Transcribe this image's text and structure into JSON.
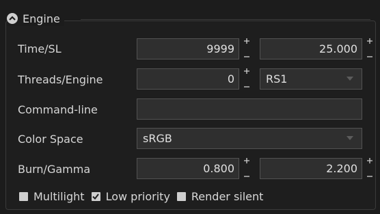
{
  "group": {
    "title": "Engine"
  },
  "rows": {
    "time": {
      "label": "Time/SL",
      "value1": "9999",
      "value2": "25.000"
    },
    "threads": {
      "label": "Threads/Engine",
      "value1": "0",
      "engine": "RS1"
    },
    "command": {
      "label": "Command-line",
      "value": ""
    },
    "color": {
      "label": "Color Space",
      "value": "sRGB"
    },
    "burn": {
      "label": "Burn/Gamma",
      "value1": "0.800",
      "value2": "2.200"
    }
  },
  "options": [
    {
      "label": "Multilight",
      "checked": false
    },
    {
      "label": "Low priority",
      "checked": true
    },
    {
      "label": "Render silent",
      "checked": false
    }
  ],
  "icons": {
    "collapse": "chevron-up-circle-icon",
    "spin_up": "plus-icon",
    "spin_down": "minus-icon",
    "dropdown": "triangle-down-icon"
  },
  "colors": {
    "background": "#1c1c1c",
    "field": "#2f2f2f",
    "field_border": "#525252",
    "text": "#d6d6d6"
  }
}
